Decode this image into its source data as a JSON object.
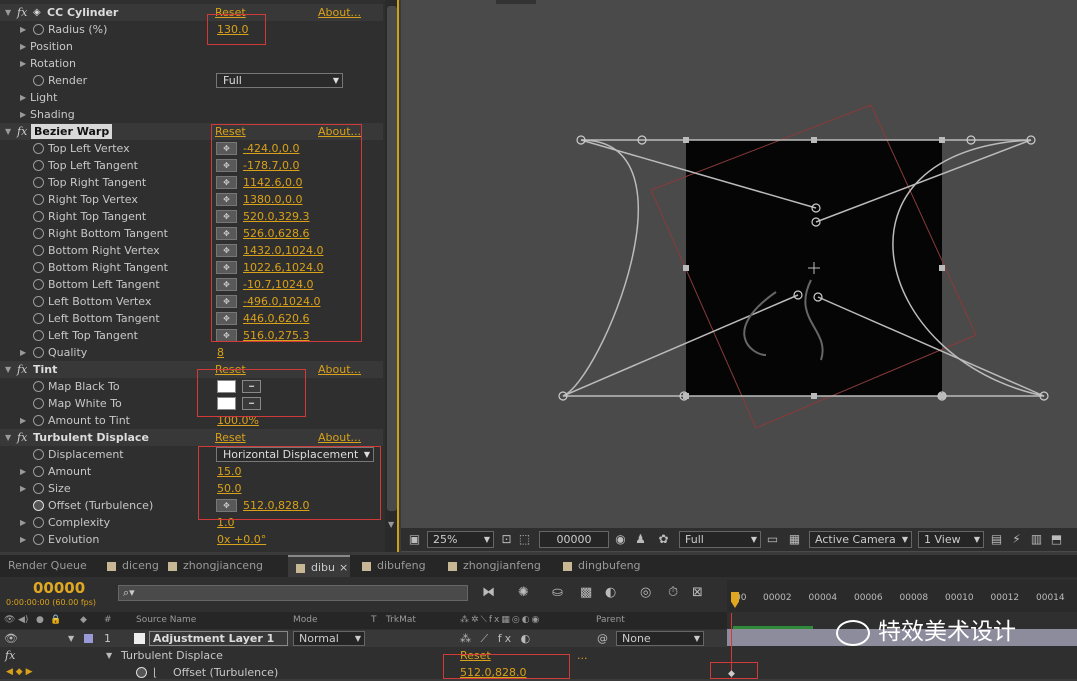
{
  "effects": {
    "cc_cylinder": {
      "name": "CC Cylinder",
      "reset": "Reset",
      "about": "About...",
      "props": [
        {
          "name": "Radius (%)",
          "value": "130.0"
        },
        {
          "name": "Position",
          "value": ""
        },
        {
          "name": "Rotation",
          "value": ""
        },
        {
          "name": "Render",
          "value": "Full"
        },
        {
          "name": "Light",
          "value": ""
        },
        {
          "name": "Shading",
          "value": ""
        }
      ]
    },
    "bezier_warp": {
      "name": "Bezier Warp",
      "reset": "Reset",
      "about": "About...",
      "props": [
        {
          "name": "Top Left Vertex",
          "value": "-424.0,0.0"
        },
        {
          "name": "Top Left Tangent",
          "value": "-178.7,0.0"
        },
        {
          "name": "Top Right Tangent",
          "value": "1142.6,0.0"
        },
        {
          "name": "Right Top Vertex",
          "value": "1380.0,0.0"
        },
        {
          "name": "Right Top Tangent",
          "value": "520.0,329.3"
        },
        {
          "name": "Right Bottom Tangent",
          "value": "526.0,628.6"
        },
        {
          "name": "Bottom Right Vertex",
          "value": "1432.0,1024.0"
        },
        {
          "name": "Bottom Right Tangent",
          "value": "1022.6,1024.0"
        },
        {
          "name": "Bottom Left Tangent",
          "value": "-10.7,1024.0"
        },
        {
          "name": "Left Bottom Vertex",
          "value": "-496.0,1024.0"
        },
        {
          "name": "Left Bottom Tangent",
          "value": "446.0,620.6"
        },
        {
          "name": "Left Top Tangent",
          "value": "516.0,275.3"
        },
        {
          "name": "Quality",
          "value": "8"
        }
      ]
    },
    "tint": {
      "name": "Tint",
      "reset": "Reset",
      "about": "About...",
      "props": [
        {
          "name": "Map Black To",
          "value": ""
        },
        {
          "name": "Map White To",
          "value": ""
        },
        {
          "name": "Amount to Tint",
          "value": "100.0%"
        }
      ]
    },
    "turbulent_displace": {
      "name": "Turbulent Displace",
      "reset": "Reset",
      "about": "About...",
      "props": [
        {
          "name": "Displacement",
          "value": "Horizontal Displacement"
        },
        {
          "name": "Amount",
          "value": "15.0"
        },
        {
          "name": "Size",
          "value": "50.0"
        },
        {
          "name": "Offset (Turbulence)",
          "value": "512.0,828.0"
        },
        {
          "name": "Complexity",
          "value": "1.0"
        },
        {
          "name": "Evolution",
          "value": "0x +0.0°"
        }
      ]
    }
  },
  "comp_bar": {
    "zoom": "25%",
    "timecode": "00000",
    "resolution": "Full",
    "camera": "Active Camera",
    "view": "1 View"
  },
  "tabs": [
    "Render Queue",
    "diceng",
    "zhongjianceng",
    "dibu",
    "dibufeng",
    "zhongjianfeng",
    "dingbufeng"
  ],
  "timeline": {
    "current_time": "00000",
    "time_sub": "0:00:00:00 (60.00 fps)",
    "search_placeholder": "⌕▾",
    "columns": {
      "num": "#",
      "source": "Source Name",
      "mode": "Mode",
      "t": "T",
      "trkmat": "TrkMat",
      "parent": "Parent"
    },
    "layer": {
      "num": "1",
      "name": "Adjustment Layer 1",
      "mode": "Normal",
      "parent": "None"
    },
    "effect_row": {
      "name": "Turbulent Displace",
      "reset": "Reset",
      "dots": "..."
    },
    "prop_row": {
      "name": "Offset (Turbulence)",
      "value": "512.0,828.0"
    },
    "ruler": [
      "00",
      "00002",
      "00004",
      "00006",
      "00008",
      "00010",
      "00012",
      "00014"
    ]
  },
  "watermark": "特效美术设计",
  "colors": {
    "accent": "#d9a11a",
    "highlight_box": "#d23a3a",
    "panel_border": "#c9a21a"
  }
}
